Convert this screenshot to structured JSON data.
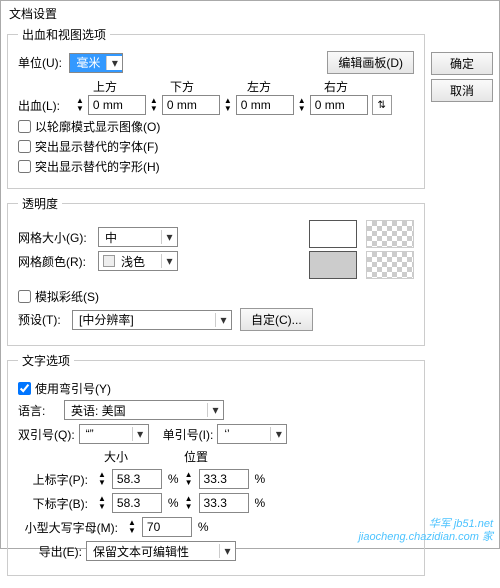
{
  "window": {
    "title": "文档设置"
  },
  "buttons": {
    "ok": "确定",
    "cancel": "取消",
    "edit_artboard": "编辑画板(D)",
    "custom": "自定(C)..."
  },
  "bleed_group": {
    "legend": "出血和视图选项",
    "unit_label": "单位(U):",
    "unit_value": "毫米",
    "headers": {
      "top": "上方",
      "bottom": "下方",
      "left": "左方",
      "right": "右方"
    },
    "bleed_label": "出血(L):",
    "bleed": {
      "top": "0 mm",
      "bottom": "0 mm",
      "left": "0 mm",
      "right": "0 mm"
    },
    "chk_outline": "以轮廓模式显示图像(O)",
    "chk_fonts": "突出显示替代的字体(F)",
    "chk_glyphs": "突出显示替代的字形(H)"
  },
  "transparency_group": {
    "legend": "透明度",
    "grid_size_label": "网格大小(G):",
    "grid_size_value": "中",
    "grid_color_label": "网格颜色(R):",
    "grid_color_value": "浅色",
    "swatch_white": "#ffffff",
    "swatch_gray": "#cccccc",
    "chk_simulate": "模拟彩纸(S)",
    "preset_label": "预设(T):",
    "preset_value": "[中分辨率]"
  },
  "text_group": {
    "legend": "文字选项",
    "chk_smartquotes": "使用弯引号(Y)",
    "lang_label": "语言:",
    "lang_value": "英语: 美国",
    "dquote_label": "双引号(Q):",
    "dquote_value": "“”",
    "squote_label": "单引号(I):",
    "squote_value": "‘’",
    "col_size": "大小",
    "col_pos": "位置",
    "super_label": "上标字(P):",
    "super_size": "58.3",
    "super_pos": "33.3",
    "sub_label": "下标字(B):",
    "sub_size": "58.3",
    "sub_pos": "33.3",
    "smallcap_label": "小型大写字母(M):",
    "smallcap_val": "70",
    "export_label": "导出(E):",
    "export_value": "保留文本可编辑性",
    "pct": "%"
  },
  "watermark": {
    "line1": "华军 jb51.net",
    "line2": "jiaocheng.chazidian.com 家"
  }
}
